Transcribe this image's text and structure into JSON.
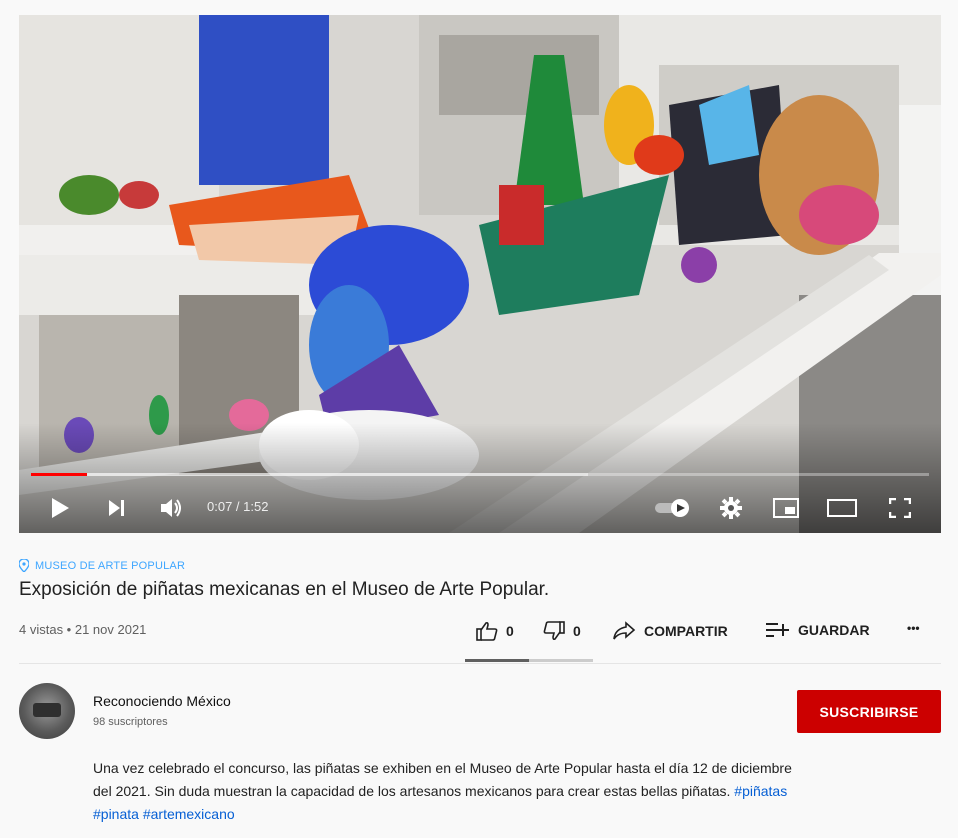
{
  "player": {
    "current_time": "0:07",
    "duration": "1:52",
    "time_display": "0:07 / 1:52",
    "progress_played": 0.0625,
    "progress_buffered": 0.62
  },
  "video": {
    "location": "MUSEO DE ARTE POPULAR",
    "title": "Exposición de piñatas mexicanas en el Museo de Arte Popular.",
    "stats": "4 vistas • 21 nov 2021",
    "likes": "0",
    "dislikes": "0",
    "share_label": "COMPARTIR",
    "save_label": "GUARDAR",
    "more_label": "•••",
    "like_ratio": 0.5
  },
  "channel": {
    "name": "Reconociendo México",
    "subscribers": "98 suscriptores",
    "subscribe_label": "SUSCRIBIRSE"
  },
  "description": {
    "text": "Una vez celebrado el concurso, las piñatas se exhiben en el Museo de Arte Popular hasta el día 12 de diciembre del 2021. Sin duda muestran la capacidad de los artesanos mexicanos para crear estas bellas piñatas.",
    "tags": [
      "#piñatas",
      "#pinata",
      "#artemexicano"
    ]
  },
  "colors": {
    "brand_red": "#cc0000",
    "progress_red": "#ff0000",
    "link_blue": "#065fd4",
    "location_blue": "#3ea6ff"
  },
  "icons": {
    "play": "play-icon",
    "next": "next-icon",
    "volume": "volume-icon",
    "autoplay": "autoplay-toggle-icon",
    "settings": "gear-icon",
    "miniplayer": "miniplayer-icon",
    "theater": "theater-mode-icon",
    "fullscreen": "fullscreen-icon",
    "location": "location-pin-icon",
    "like": "thumbs-up-icon",
    "dislike": "thumbs-down-icon",
    "share": "share-arrow-icon",
    "save": "playlist-add-icon"
  }
}
